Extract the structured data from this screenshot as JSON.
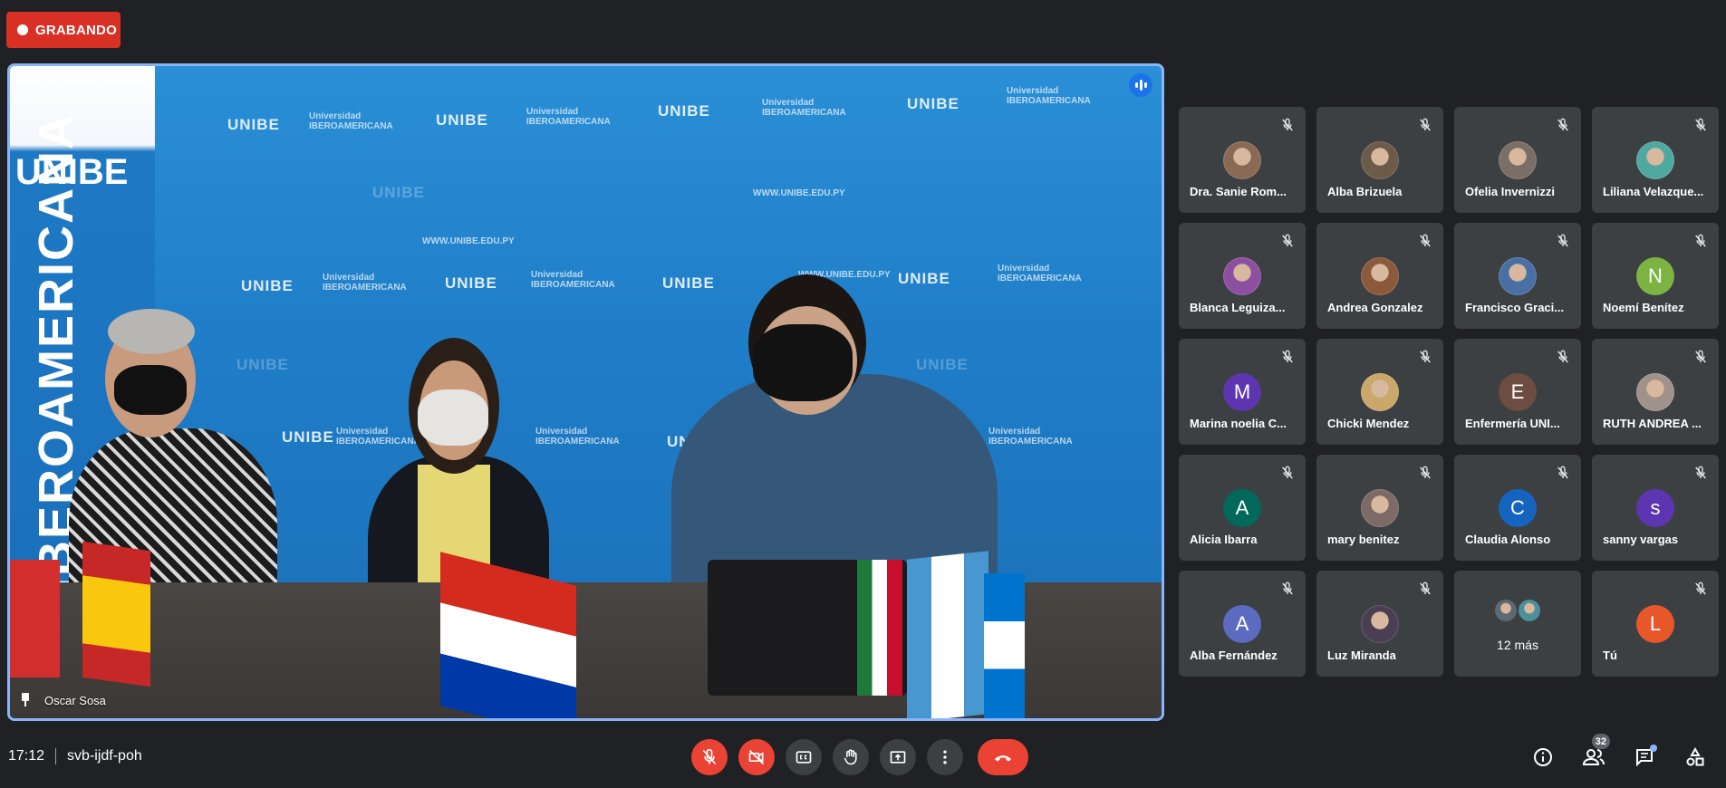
{
  "recording": {
    "label": "GRABANDO"
  },
  "main_video": {
    "speaker_name": "Oscar Sosa",
    "backdrop": {
      "brand_short": "UNIBE",
      "brand_long": "Universidad IBEROAMERICANA",
      "url": "WWW.UNIBE.EDU.PY",
      "banner_text": "IBEROAMERICANA"
    }
  },
  "participants": [
    {
      "name": "Dra. Sanie Rom...",
      "avatar_type": "photo",
      "color": "#8a6a55",
      "initial": ""
    },
    {
      "name": "Alba Brizuela",
      "avatar_type": "photo",
      "color": "#6d5b4a",
      "initial": ""
    },
    {
      "name": "Ofelia Invernizzi",
      "avatar_type": "photo",
      "color": "#7a6e66",
      "initial": ""
    },
    {
      "name": "Liliana Velazque...",
      "avatar_type": "photo",
      "color": "#4fa9a0",
      "initial": ""
    },
    {
      "name": "Blanca Leguiza...",
      "avatar_type": "photo",
      "color": "#8d4fa0",
      "initial": ""
    },
    {
      "name": "Andrea Gonzalez",
      "avatar_type": "photo",
      "color": "#8b5a3c",
      "initial": ""
    },
    {
      "name": "Francisco Graci...",
      "avatar_type": "photo",
      "color": "#4a6fa5",
      "initial": ""
    },
    {
      "name": "Noemí Benítez",
      "avatar_type": "initial",
      "color": "#7cb342",
      "initial": "N"
    },
    {
      "name": "Marina noelia C...",
      "avatar_type": "initial",
      "color": "#5e35b1",
      "initial": "M"
    },
    {
      "name": "Chicki Mendez",
      "avatar_type": "photo",
      "color": "#c9a86a",
      "initial": ""
    },
    {
      "name": "Enfermería UNI...",
      "avatar_type": "initial",
      "color": "#6d4c41",
      "initial": "E"
    },
    {
      "name": "RUTH ANDREA ...",
      "avatar_type": "photo",
      "color": "#a0928a",
      "initial": ""
    },
    {
      "name": "Alicia Ibarra",
      "avatar_type": "initial",
      "color": "#00695c",
      "initial": "A"
    },
    {
      "name": "mary benitez",
      "avatar_type": "photo",
      "color": "#7d6a66",
      "initial": ""
    },
    {
      "name": "Claudia Alonso",
      "avatar_type": "initial",
      "color": "#1565c0",
      "initial": "C"
    },
    {
      "name": "sanny vargas",
      "avatar_type": "initial",
      "color": "#5e35b1",
      "initial": "s"
    },
    {
      "name": "Alba Fernández",
      "avatar_type": "initial",
      "color": "#5c6bc0",
      "initial": "A"
    },
    {
      "name": "Luz Miranda",
      "avatar_type": "photo",
      "color": "#4a3f52",
      "initial": ""
    }
  ],
  "more_tile": {
    "label": "12 más"
  },
  "self_tile": {
    "name": "Tú",
    "initial": "L",
    "color": "#e8572a"
  },
  "bottom_bar": {
    "time": "17:12",
    "meeting_code": "svb-ijdf-poh",
    "participant_count": "32"
  },
  "controls": {
    "icons": [
      "mic-off-icon",
      "camera-off-icon",
      "captions-icon",
      "raise-hand-icon",
      "present-icon",
      "more-options-icon",
      "end-call-icon"
    ]
  },
  "colors": {
    "accent": "#8ab4f8",
    "danger": "#ea4335",
    "tile": "#3c4043",
    "background": "#202124"
  }
}
